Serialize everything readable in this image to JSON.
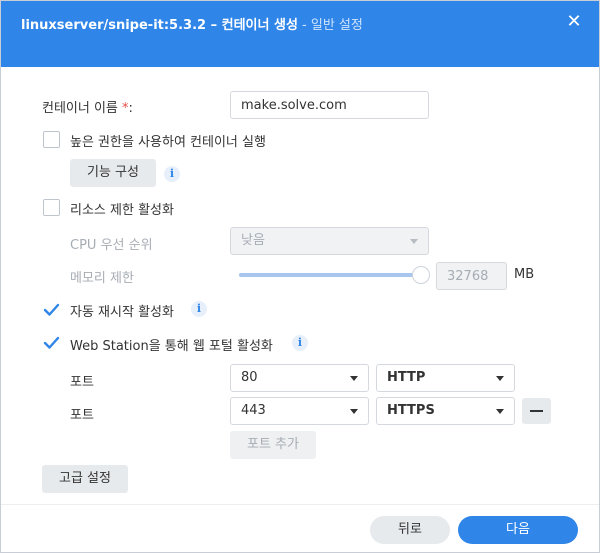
{
  "title": {
    "main": "linuxserver/snipe-it:5.3.2 – 컨테이너 생성",
    "sub": " - 일반 설정"
  },
  "form": {
    "container_name_label": "컨테이너 이름",
    "required_mark": "*",
    "colon": ":",
    "container_name_value": "make.solve.com",
    "high_privilege_label": "높은 권한을 사용하여 컨테이너 실행",
    "high_privilege_checked": false,
    "capabilities_button": "기능 구성",
    "resource_limit_label": "리소스 제한 활성화",
    "resource_limit_checked": false,
    "cpu_priority_label": "CPU 우선 순위",
    "cpu_priority_value": "낮음",
    "memory_limit_label": "메모리 제한",
    "memory_limit_value": "32768",
    "memory_unit": "MB",
    "memory_slider_level": 1.0,
    "auto_restart_label": "자동 재시작 활성화",
    "auto_restart_checked": true,
    "web_station_label": "Web Station을 통해 웹 포털 활성화",
    "web_station_checked": true,
    "ports": [
      {
        "label": "포트",
        "port": "80",
        "protocol": "HTTP"
      },
      {
        "label": "포트",
        "port": "443",
        "protocol": "HTTPS"
      }
    ],
    "add_port_button": "포트 추가",
    "advanced_button": "고급 설정"
  },
  "footer": {
    "back_button": "뒤로",
    "next_button": "다음"
  },
  "colors": {
    "accent": "#2f86e8",
    "required": "#e34d4d"
  }
}
